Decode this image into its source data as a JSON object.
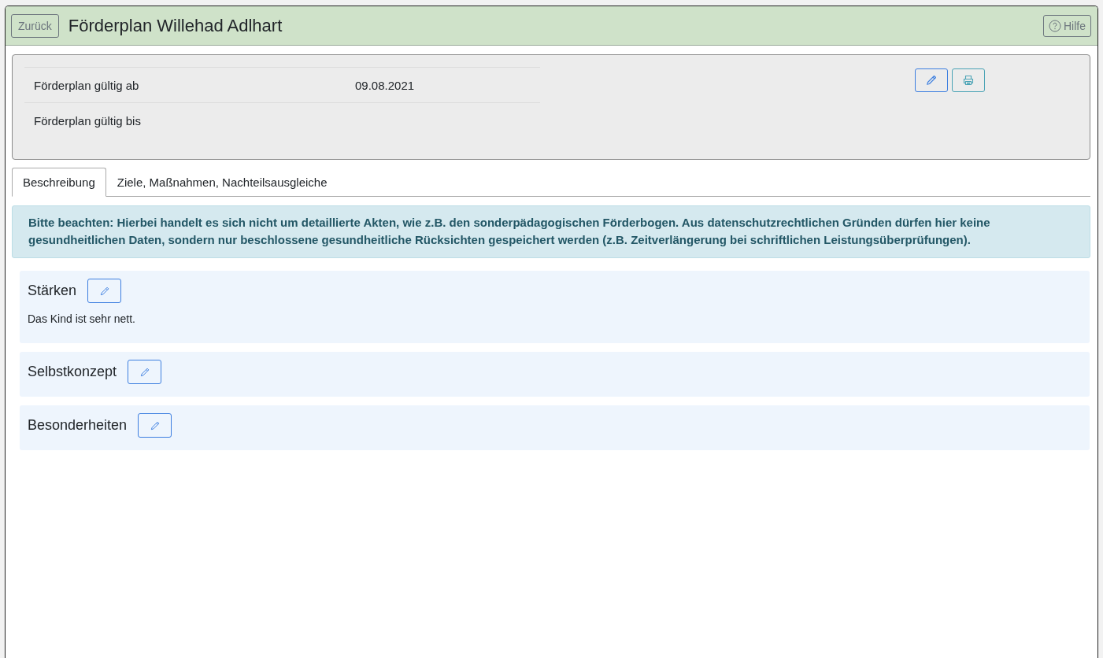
{
  "header": {
    "back_button": "Zurück",
    "title": "Förderplan Willehad Adlhart",
    "help_button": "Hilfe"
  },
  "details": {
    "rows": [
      {
        "label": "Förderplan gültig ab",
        "value": "09.08.2021"
      },
      {
        "label": "Förderplan gültig bis"
      }
    ]
  },
  "tabs": [
    {
      "label": "Beschreibung",
      "selected": true
    },
    {
      "label": "Ziele, Maßnahmen, Nachteilsausgleiche",
      "selected": false
    }
  ],
  "notice": "Bitte beachten: Hierbei handelt es sich nicht um detaillierte Akten, wie z.B. den sonderpädagogischen Förderbogen. Aus datenschutzrechtlichen Gründen dürfen hier keine gesundheitlichen Daten, sondern nur beschlossene gesundheitliche Rücksichten gespeichert werden (z.B. Zeitverlängerung bei schriftlichen Leistungsüberprüfungen).",
  "sections": [
    {
      "title": "Stärken",
      "text": "Das Kind ist sehr nett."
    },
    {
      "title": "Selbstkonzept"
    },
    {
      "title": "Besonderheiten"
    }
  ]
}
